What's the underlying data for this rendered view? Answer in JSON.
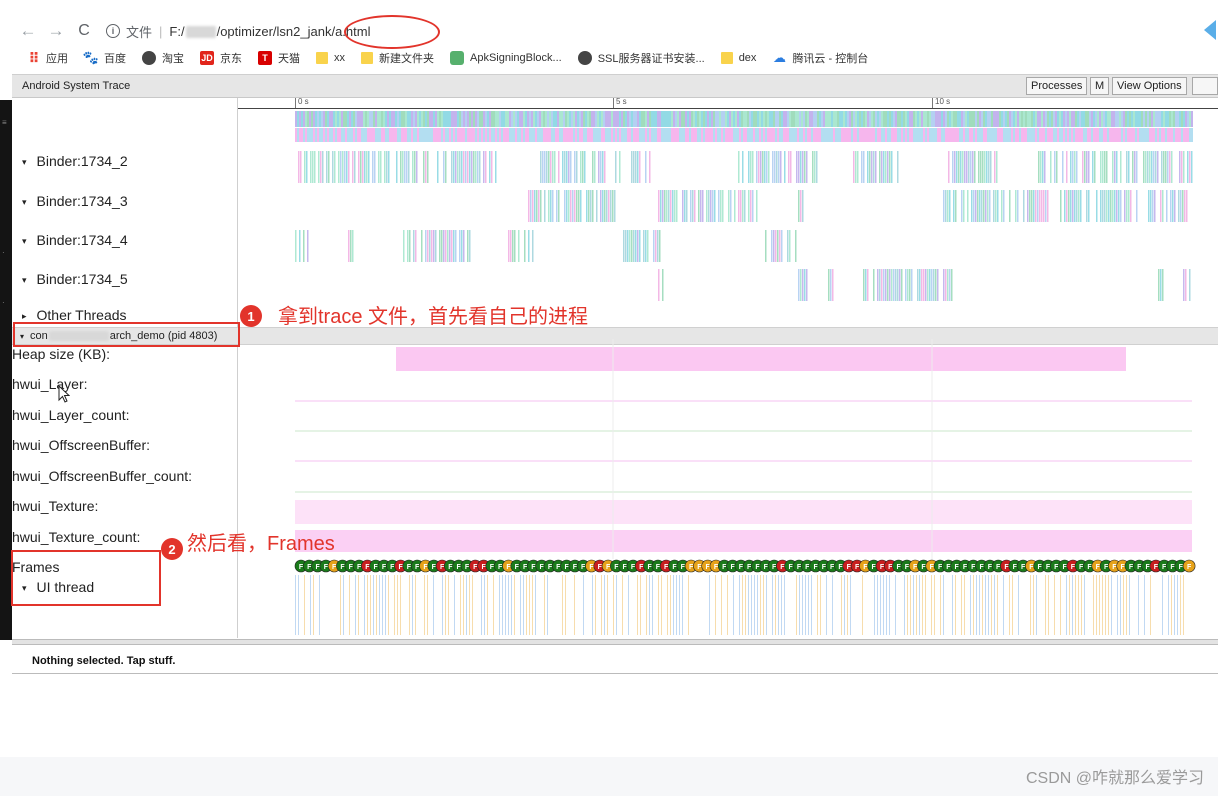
{
  "browser": {
    "back_glyph": "←",
    "forward_glyph": "→",
    "reload_glyph": "C",
    "info_glyph": "i",
    "url_label": "文件",
    "url_separator": "|",
    "url_prefix": "F:/",
    "url_path": "/optimizer/lsn2_jank/a.html"
  },
  "bookmarks": [
    {
      "icon": "apps-icon",
      "glyph": "⠿",
      "label": "应用"
    },
    {
      "icon": "baidu-icon",
      "glyph": "🐾",
      "label": "百度"
    },
    {
      "icon": "taobao-icon",
      "glyph": "",
      "label": "淘宝"
    },
    {
      "icon": "jd-icon",
      "glyph": "JD",
      "label": "京东"
    },
    {
      "icon": "tmall-icon",
      "glyph": "T",
      "label": "天猫"
    },
    {
      "icon": "folder-icon",
      "glyph": "",
      "label": "xx"
    },
    {
      "icon": "folder-icon",
      "glyph": "",
      "label": "新建文件夹"
    },
    {
      "icon": "android-icon",
      "glyph": "",
      "label": "ApkSigningBlock..."
    },
    {
      "icon": "ssl-icon",
      "glyph": "",
      "label": "SSL服务器证书安装..."
    },
    {
      "icon": "folder-icon",
      "glyph": "",
      "label": "dex"
    },
    {
      "icon": "cloud-icon",
      "glyph": "☁",
      "label": "腾讯云 - 控制台"
    }
  ],
  "trace": {
    "title": "Android System Trace",
    "buttons": {
      "processes": "Processes",
      "m": "M",
      "view_options": "View Options"
    },
    "ruler_ticks": [
      "0 s",
      "5 s",
      "10 s"
    ],
    "threads": [
      {
        "label": "Binder:1734_2",
        "glyph": "▾"
      },
      {
        "label": "Binder:1734_3",
        "glyph": "▾"
      },
      {
        "label": "Binder:1734_4",
        "glyph": "▾"
      },
      {
        "label": "Binder:1734_5",
        "glyph": "▾"
      },
      {
        "label": "Other Threads",
        "glyph": "▸"
      }
    ],
    "process": {
      "glyph": "▾",
      "prefix": "con",
      "suffix": "arch_demo (pid 4803)"
    },
    "counters": [
      "Heap size (KB):",
      "hwui_Layer:",
      "hwui_Layer_count:",
      "hwui_OffscreenBuffer:",
      "hwui_OffscreenBuffer_count:",
      "hwui_Texture:",
      "hwui_Texture_count:"
    ],
    "frames_label": "Frames",
    "ui_thread": {
      "glyph": "▾",
      "label": "UI thread"
    },
    "frame_letter": "F",
    "frame_colors": {
      "good": "#1a7a1a",
      "warn": "#e6a21a",
      "bad": "#c81e1e"
    },
    "selection_text": "Nothing selected. Tap stuff."
  },
  "annotations": {
    "step1": {
      "number": "1",
      "text": "拿到trace 文件，首先看自己的进程"
    },
    "step2": {
      "number": "2",
      "text": "然后看，Frames"
    }
  },
  "watermark": "CSDN @咋就那么爱学习"
}
